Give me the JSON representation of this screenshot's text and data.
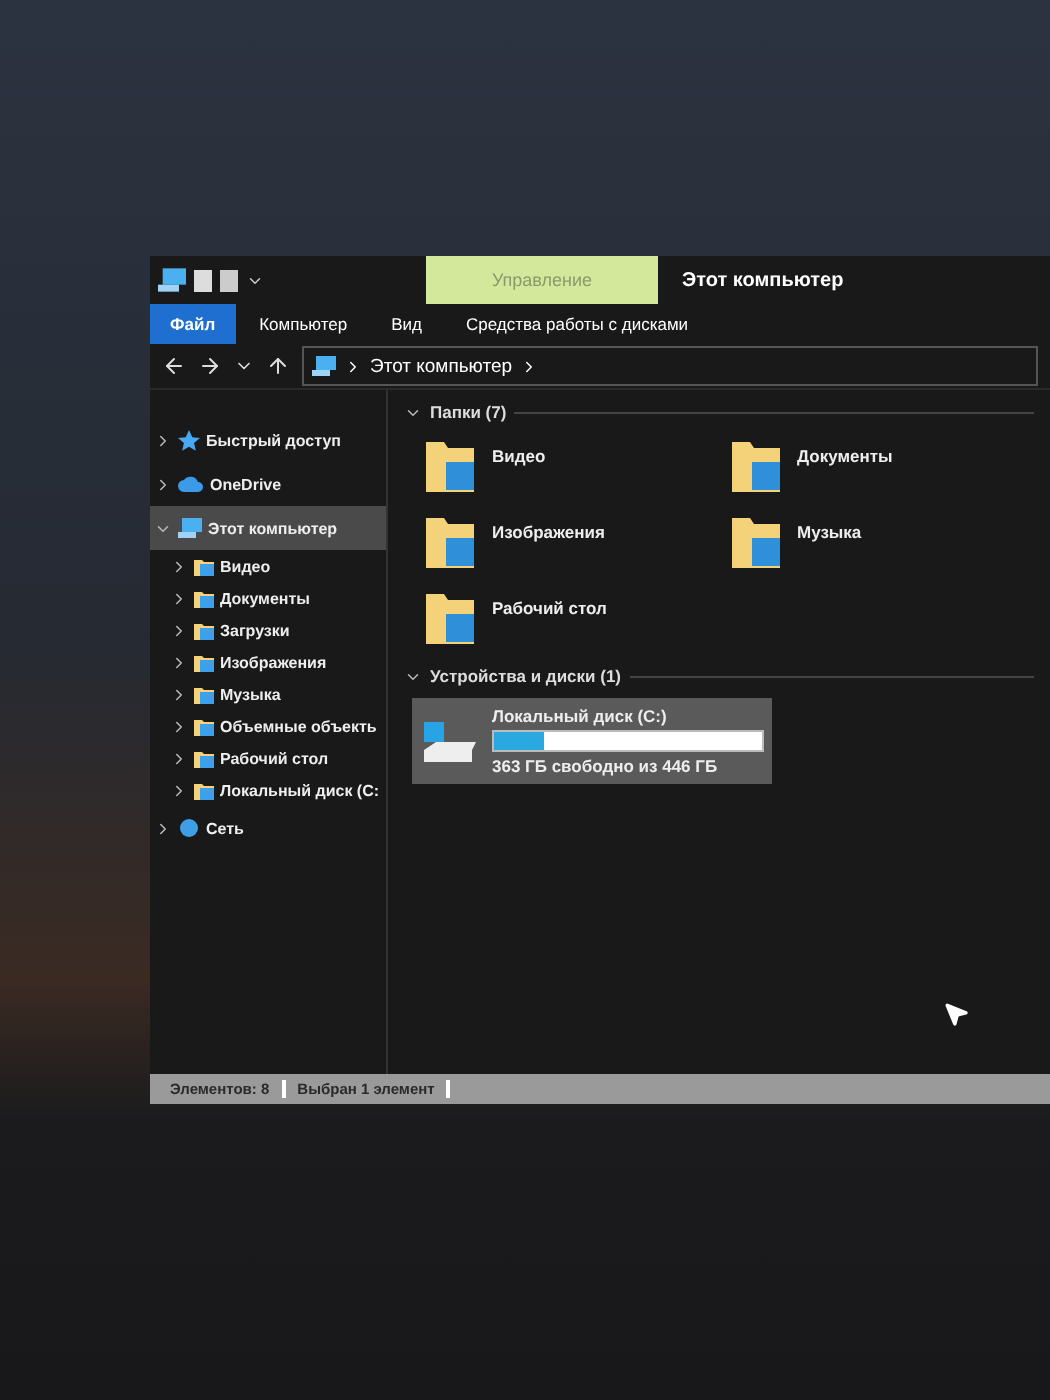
{
  "window": {
    "title": "Этот компьютер",
    "context_tab": "Управление"
  },
  "ribbon_tabs": [
    {
      "label": "Файл",
      "selected": true
    },
    {
      "label": "Компьютер",
      "selected": false
    },
    {
      "label": "Вид",
      "selected": false
    },
    {
      "label": "Средства работы с дисками",
      "selected": false
    }
  ],
  "address": {
    "path": "Этот компьютер"
  },
  "sidebar": {
    "items": [
      {
        "label": "Быстрый доступ",
        "expanded": false,
        "selected": false
      },
      {
        "label": "OneDrive",
        "expanded": false,
        "selected": false
      },
      {
        "label": "Этот компьютер",
        "expanded": true,
        "selected": true,
        "children": [
          {
            "label": "Видео",
            "expanded": false
          },
          {
            "label": "Документы",
            "expanded": false
          },
          {
            "label": "Загрузки",
            "expanded": false
          },
          {
            "label": "Изображения",
            "expanded": false
          },
          {
            "label": "Музыка",
            "expanded": false
          },
          {
            "label": "Объемные объекть",
            "expanded": false
          },
          {
            "label": "Рабочий стол",
            "expanded": false
          },
          {
            "label": "Локальный диск (С:",
            "expanded": false
          }
        ]
      },
      {
        "label": "Сеть",
        "expanded": false,
        "selected": false
      }
    ]
  },
  "folders": {
    "title": "Папки (7)",
    "expanded": true,
    "items": [
      {
        "label": "Видео"
      },
      {
        "label": "Документы"
      },
      {
        "label": "Изображения"
      },
      {
        "label": "Музыка"
      },
      {
        "label": "Рабочий стол"
      }
    ]
  },
  "devices": {
    "title": "Устройства и диски (1)",
    "expanded": true,
    "items": [
      {
        "label": "Локальный диск (C:)",
        "level": 0.19,
        "free": "363 ГБ свободно из 446 ГБ",
        "selected": true
      }
    ]
  },
  "status_bar": [
    "Элементов: 8",
    "Выбран 1 элемент"
  ]
}
